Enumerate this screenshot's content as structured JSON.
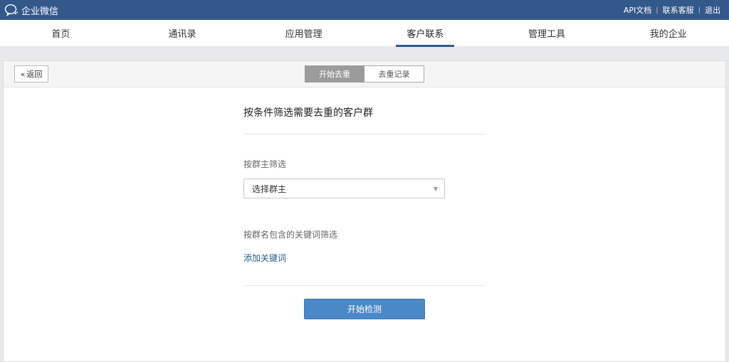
{
  "topbar": {
    "brand": "企业微信",
    "links": [
      "API文档",
      "联系客服",
      "退出"
    ]
  },
  "nav": {
    "items": [
      "首页",
      "通讯录",
      "应用管理",
      "客户联系",
      "管理工具",
      "我的企业"
    ],
    "active_index": 3
  },
  "panel": {
    "back_label": "返回",
    "tabs": [
      "开始去重",
      "去重记录"
    ],
    "active_tab": 0
  },
  "form": {
    "title": "按条件筛选需要去重的客户群",
    "owner_label": "按群主筛选",
    "owner_select_value": "选择群主",
    "keyword_label": "按群名包含的关键词筛选",
    "add_keyword": "添加关键词",
    "start_button": "开始检测"
  },
  "colors": {
    "topbar": "#33588a",
    "primary_button": "#4a88c8",
    "link": "#2a5a8f"
  }
}
